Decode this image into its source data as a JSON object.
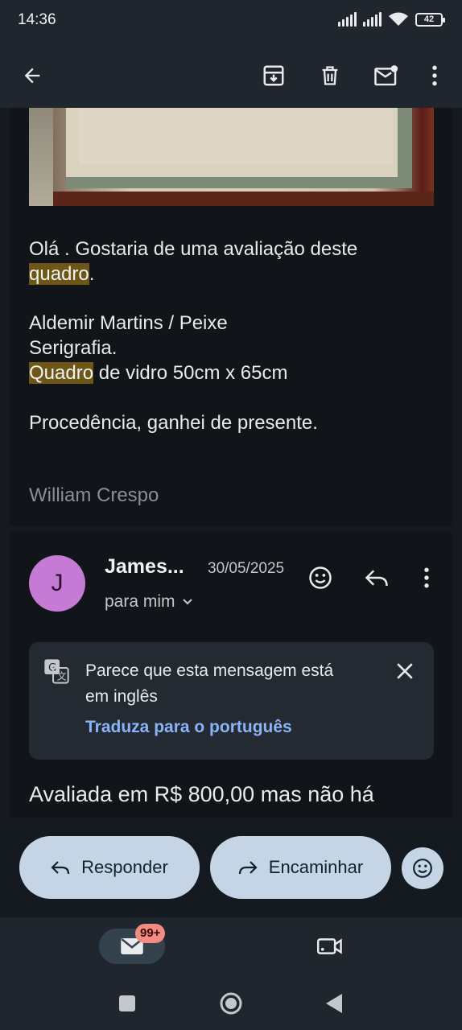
{
  "status_bar": {
    "time": "14:36",
    "battery": "42"
  },
  "toolbar": {
    "back_icon": "arrow-left-icon",
    "archive_icon": "archive-icon",
    "delete_icon": "trash-icon",
    "unread_icon": "mark-unread-icon",
    "more_icon": "more-vert-icon"
  },
  "message1": {
    "line1_a": "Olá . Gostaria de uma avaliação deste",
    "line1_hl": "quadro",
    "line1_b": ".",
    "line2": "Aldemir Martins / Peixe",
    "line3": "Serigrafia.",
    "line4_hl": "Quadro",
    "line4_b": " de vidro 50cm x 65cm",
    "line5": "Procedência, ganhei de presente.",
    "signature": "William Crespo"
  },
  "message2": {
    "avatar_letter": "J",
    "sender": "James...",
    "date": "30/05/2025",
    "recipient": "para mim",
    "translate": {
      "message": "Parece que esta mensagem está em inglês",
      "link": "Traduza para o português"
    },
    "body_start": "Avaliada em R$ 800,00 mas não há"
  },
  "actions": {
    "reply": "Responder",
    "forward": "Encaminhar"
  },
  "bottom_nav": {
    "mail_badge": "99+"
  }
}
